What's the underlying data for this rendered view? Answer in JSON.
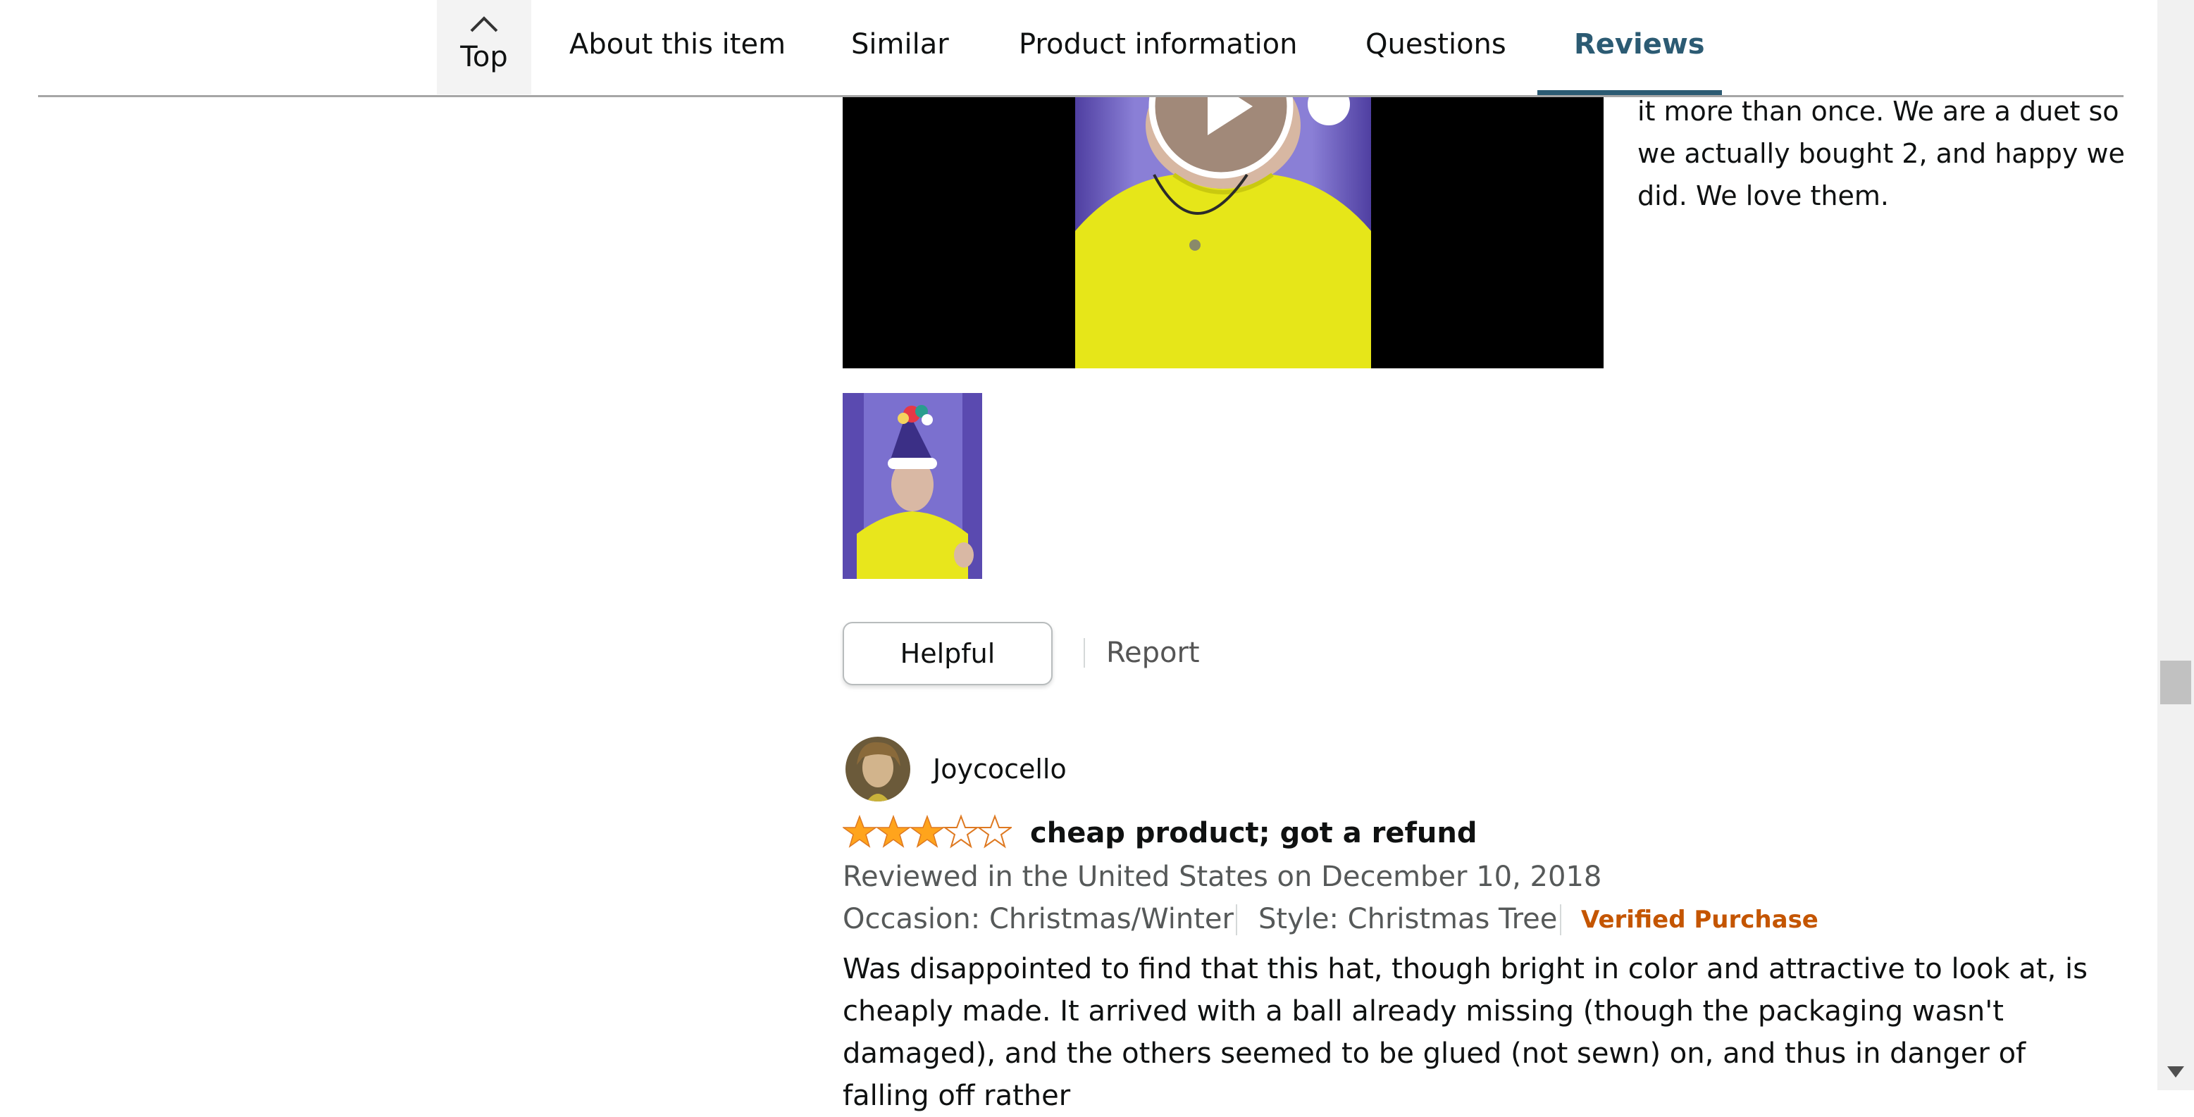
{
  "nav": {
    "top_label": "Top",
    "tabs": [
      {
        "label": "About this item"
      },
      {
        "label": "Similar"
      },
      {
        "label": "Product information"
      },
      {
        "label": "Questions"
      },
      {
        "label": "Reviews"
      }
    ],
    "active_tab": "Reviews"
  },
  "first_review": {
    "text_tail": "it more than once. We are a duet so we actually bought 2, and happy we did. We love them.",
    "video_icon": "play-icon",
    "thumbnail": "review-image-thumbnail",
    "helpful_label": "Helpful",
    "report_label": "Report"
  },
  "second_review": {
    "reviewer": "Joycocello",
    "rating": 3,
    "rating_max": 5,
    "title": "cheap product; got a refund",
    "date": "Reviewed in the United States on December 10, 2018",
    "occasion": "Occasion: Christmas/Winter",
    "style": "Style: Christmas Tree",
    "verified": "Verified Purchase",
    "body": "Was disappointed to find that this hat, though bright in color and attractive to look at, is cheaply made. It arrived with a ball already missing (though the packaging wasn't damaged), and the others seemed to be glued (not sewn) on, and thus in danger of falling off rather"
  },
  "colors": {
    "accent": "#2c5b73",
    "star": "#ffa41c",
    "verified": "#c45500",
    "muted_text": "#565959"
  }
}
